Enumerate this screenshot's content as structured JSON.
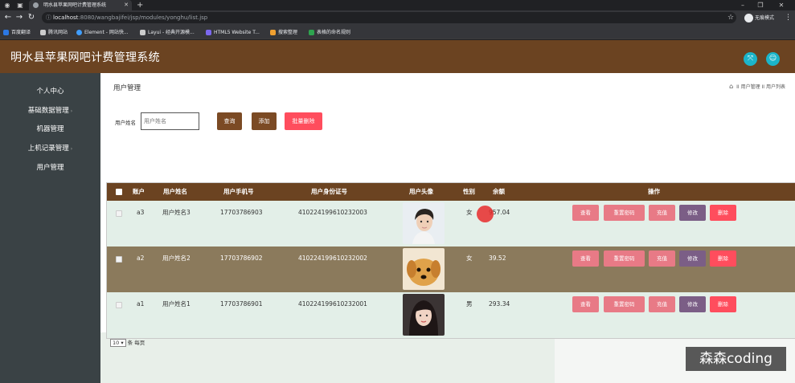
{
  "browser": {
    "tab_title": "明水县苹果网吧计费管理系统",
    "url_host": "localhost",
    "url_rest": ":8080/wangbajifei/jsp/modules/yonghu/list.jsp",
    "incognito_label": "无痕模式",
    "bookmarks": [
      "百度翻译",
      "腾讯网站",
      "Element - 网站快...",
      "Layui - 经典开源模...",
      "HTML5 Website T...",
      "搜索整理",
      "表格的命名规则"
    ]
  },
  "app": {
    "title": "明水县苹果网吧计费管理系统",
    "colors": {
      "header": "#6b4321",
      "sidebar": "#3a4245",
      "accent": "#1bb4c9",
      "danger": "#ff4d5d"
    }
  },
  "sidebar": {
    "items": [
      {
        "label": "个人中心"
      },
      {
        "label": "基础数据管理"
      },
      {
        "label": "机器管理"
      },
      {
        "label": "上机记录管理"
      },
      {
        "label": "用户管理"
      }
    ]
  },
  "page": {
    "heading": "用户管理",
    "breadcrumb": [
      "用户管理",
      "用户列表"
    ],
    "separator": "II"
  },
  "search": {
    "label": "用户姓名",
    "placeholder": "用户姓名",
    "query_btn": "查询",
    "add_btn": "添加",
    "batch_delete_btn": "批量删除"
  },
  "table": {
    "columns": [
      "账户",
      "用户姓名",
      "用户手机号",
      "用户身份证号",
      "用户头像",
      "性别",
      "余额",
      "操作"
    ],
    "rows": [
      {
        "account": "a3",
        "name": "用户姓名3",
        "phone": "17703786903",
        "idcard": "410224199610232003",
        "avatar": "boy-photo",
        "gender": "女",
        "balance": "957.04"
      },
      {
        "account": "a2",
        "name": "用户姓名2",
        "phone": "17703786902",
        "idcard": "410224199610232002",
        "avatar": "puppy-photo",
        "gender": "女",
        "balance": "39.52"
      },
      {
        "account": "a1",
        "name": "用户姓名1",
        "phone": "17703786901",
        "idcard": "410224199610232001",
        "avatar": "girl-photo",
        "gender": "男",
        "balance": "293.34"
      }
    ],
    "actions": {
      "view": "查看",
      "reset_pwd": "重置密码",
      "recharge": "充值",
      "edit": "修改",
      "delete": "删除"
    }
  },
  "pager": {
    "page_size": "10",
    "suffix": "条 每页"
  },
  "watermark": "森森coding"
}
